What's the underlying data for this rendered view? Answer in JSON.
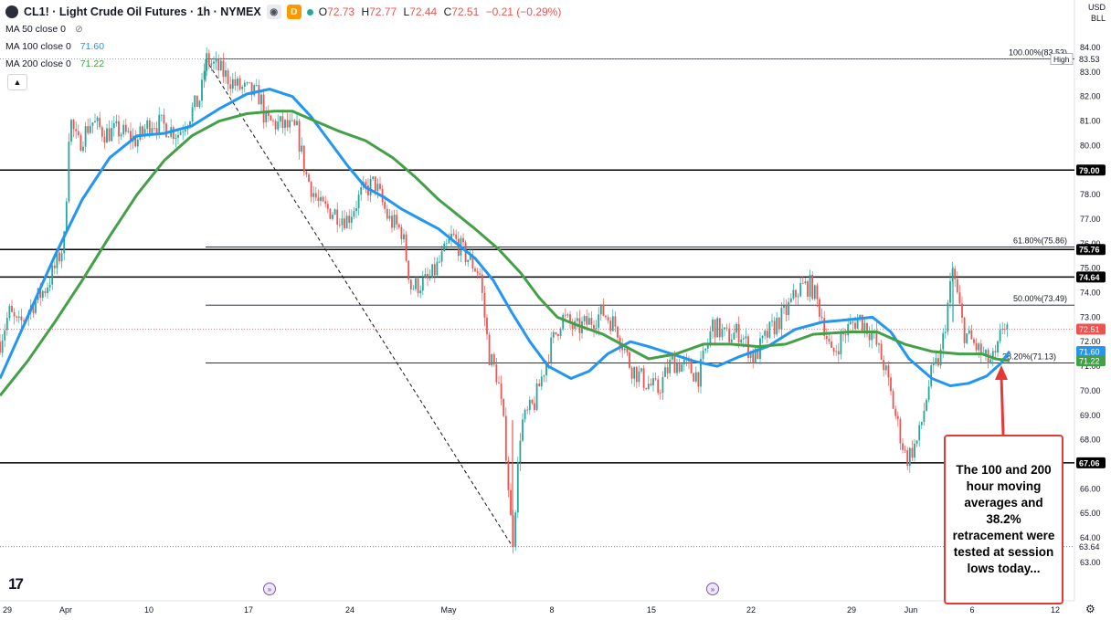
{
  "header": {
    "title": "CL1! · Light Crude Oil Futures · 1h · NYMEX",
    "badge_d": "D",
    "ohlc": [
      {
        "k": "O",
        "v": "72.73"
      },
      {
        "k": "H",
        "v": "72.77"
      },
      {
        "k": "L",
        "v": "72.44"
      },
      {
        "k": "C",
        "v": "72.51"
      }
    ],
    "change": "−0.21 (−0.29%)"
  },
  "indicators": [
    {
      "label": "MA 50 close 0",
      "value": ""
    },
    {
      "label": "MA 100 close 0",
      "value": "71.60"
    },
    {
      "label": "MA 200 close 0",
      "value": "71.22"
    }
  ],
  "currency": {
    "line1": "USD",
    "line2": "BLL"
  },
  "annotation": "The 100 and 200 hour moving averages and 38.2% retracement were tested at session lows today...",
  "colors": {
    "up": "#26a69a",
    "down": "#ef5350",
    "ma100": "#2196f3",
    "ma200": "#43a047",
    "annotation": "#e53935",
    "hline": "#000000",
    "fib": "#131722"
  },
  "chart_data": {
    "type": "candlestick",
    "instrument": "CL1!",
    "timeframe": "1h",
    "xlabel": "",
    "ylabel": "",
    "ylim": [
      62,
      84
    ],
    "y_ticks": [
      63,
      64,
      65,
      66,
      67,
      68,
      69,
      70,
      71,
      72,
      73,
      74,
      75,
      76,
      77,
      78,
      79,
      80,
      81,
      82,
      83,
      84
    ],
    "x_ticks": [
      "29",
      "Apr",
      "10",
      "17",
      "24",
      "May",
      "8",
      "15",
      "22",
      "29",
      "Jun",
      "6",
      "12"
    ],
    "fib_levels": [
      {
        "label": "100.00%(83.53)",
        "value": 83.53
      },
      {
        "label": "61.80%(75.86)",
        "value": 75.86
      },
      {
        "label": "50.00%(73.49)",
        "value": 73.49
      },
      {
        "label": "38.20%(71.13)",
        "value": 71.13
      }
    ],
    "horizontal_lines": [
      79.0,
      75.76,
      74.64,
      67.06
    ],
    "price_badges": [
      {
        "label": "79.00",
        "value": 79.0,
        "kind": "line"
      },
      {
        "label": "75.76",
        "value": 75.76,
        "kind": "line"
      },
      {
        "label": "74.64",
        "value": 74.64,
        "kind": "line"
      },
      {
        "label": "72.51",
        "value": 72.51,
        "kind": "last"
      },
      {
        "label": "71.60",
        "value": 71.6,
        "kind": "ma100"
      },
      {
        "label": "71.22",
        "value": 71.22,
        "kind": "ma200"
      },
      {
        "label": "67.06",
        "value": 67.06,
        "kind": "line"
      },
      {
        "label": "83.53",
        "value": 83.53,
        "kind": "high",
        "tag": "High"
      },
      {
        "label": "63.64",
        "value": 63.64,
        "kind": "low"
      }
    ],
    "last_price": 72.51,
    "price_path": [
      [
        0,
        72.0
      ],
      [
        10,
        73.2
      ],
      [
        20,
        72.6
      ],
      [
        35,
        73.5
      ],
      [
        50,
        74.2
      ],
      [
        60,
        75.0
      ],
      [
        70,
        76.0
      ],
      [
        74,
        79.0
      ],
      [
        76,
        81.2
      ],
      [
        85,
        80.0
      ],
      [
        100,
        81.0
      ],
      [
        115,
        80.5
      ],
      [
        130,
        80.6
      ],
      [
        150,
        80.2
      ],
      [
        165,
        81.0
      ],
      [
        180,
        80.8
      ],
      [
        195,
        80.5
      ],
      [
        210,
        81.4
      ],
      [
        220,
        82.0
      ],
      [
        225,
        83.53
      ],
      [
        240,
        83.1
      ],
      [
        260,
        82.4
      ],
      [
        285,
        82.0
      ],
      [
        290,
        81.0
      ],
      [
        310,
        80.8
      ],
      [
        325,
        80.6
      ],
      [
        335,
        78.8
      ],
      [
        350,
        77.5
      ],
      [
        365,
        77.3
      ],
      [
        380,
        77.0
      ],
      [
        395,
        78.0
      ],
      [
        410,
        78.5
      ],
      [
        425,
        77.0
      ],
      [
        440,
        76.5
      ],
      [
        450,
        74.2
      ],
      [
        470,
        74.5
      ],
      [
        485,
        75.5
      ],
      [
        495,
        76.3
      ],
      [
        510,
        75.5
      ],
      [
        525,
        74.8
      ],
      [
        535,
        71.5
      ],
      [
        545,
        70.5
      ],
      [
        553,
        68.0
      ],
      [
        561,
        63.64
      ],
      [
        570,
        68.6
      ],
      [
        585,
        69.5
      ],
      [
        600,
        71.5
      ],
      [
        615,
        73.0
      ],
      [
        630,
        72.5
      ],
      [
        645,
        72.8
      ],
      [
        660,
        73.2
      ],
      [
        675,
        72.6
      ],
      [
        690,
        71.0
      ],
      [
        705,
        70.4
      ],
      [
        720,
        70.0
      ],
      [
        735,
        71.2
      ],
      [
        750,
        71.0
      ],
      [
        765,
        70.6
      ],
      [
        780,
        72.7
      ],
      [
        795,
        72.2
      ],
      [
        810,
        72.4
      ],
      [
        825,
        71.3
      ],
      [
        840,
        72.3
      ],
      [
        860,
        73.2
      ],
      [
        875,
        74.2
      ],
      [
        888,
        74.3
      ],
      [
        900,
        73.0
      ],
      [
        910,
        71.4
      ],
      [
        925,
        72.4
      ],
      [
        940,
        73.0
      ],
      [
        955,
        72.3
      ],
      [
        968,
        71.0
      ],
      [
        980,
        69.0
      ],
      [
        992,
        67.2
      ],
      [
        1005,
        68.0
      ],
      [
        1018,
        70.5
      ],
      [
        1030,
        71.5
      ],
      [
        1043,
        75.0
      ],
      [
        1048,
        73.8
      ],
      [
        1055,
        72.4
      ],
      [
        1068,
        71.8
      ],
      [
        1080,
        71.2
      ],
      [
        1090,
        71.3
      ],
      [
        1098,
        72.8
      ],
      [
        1105,
        72.51
      ]
    ],
    "series": [
      {
        "name": "MA 100 close 0",
        "values": [
          [
            0,
            70.5
          ],
          [
            30,
            73.0
          ],
          [
            60,
            75.5
          ],
          [
            90,
            77.8
          ],
          [
            120,
            79.5
          ],
          [
            150,
            80.4
          ],
          [
            180,
            80.5
          ],
          [
            210,
            80.8
          ],
          [
            240,
            81.5
          ],
          [
            270,
            82.1
          ],
          [
            295,
            82.3
          ],
          [
            320,
            82.0
          ],
          [
            340,
            81.2
          ],
          [
            360,
            80.2
          ],
          [
            380,
            79.2
          ],
          [
            400,
            78.3
          ],
          [
            420,
            77.9
          ],
          [
            440,
            77.4
          ],
          [
            460,
            77.0
          ],
          [
            480,
            76.6
          ],
          [
            500,
            76.0
          ],
          [
            520,
            75.4
          ],
          [
            540,
            74.5
          ],
          [
            560,
            73.2
          ],
          [
            580,
            72.0
          ],
          [
            600,
            71.0
          ],
          [
            625,
            70.5
          ],
          [
            645,
            70.8
          ],
          [
            665,
            71.5
          ],
          [
            690,
            72.0
          ],
          [
            710,
            71.8
          ],
          [
            735,
            71.5
          ],
          [
            760,
            71.2
          ],
          [
            785,
            71.0
          ],
          [
            810,
            71.4
          ],
          [
            840,
            71.8
          ],
          [
            870,
            72.5
          ],
          [
            900,
            72.8
          ],
          [
            930,
            72.9
          ],
          [
            955,
            73.0
          ],
          [
            975,
            72.4
          ],
          [
            995,
            71.3
          ],
          [
            1020,
            70.5
          ],
          [
            1040,
            70.2
          ],
          [
            1060,
            70.3
          ],
          [
            1080,
            70.6
          ],
          [
            1095,
            71.1
          ],
          [
            1105,
            71.6
          ]
        ]
      },
      {
        "name": "MA 200 close 0",
        "values": [
          [
            0,
            69.8
          ],
          [
            30,
            71.2
          ],
          [
            60,
            72.8
          ],
          [
            90,
            74.5
          ],
          [
            120,
            76.3
          ],
          [
            150,
            78.0
          ],
          [
            180,
            79.4
          ],
          [
            210,
            80.4
          ],
          [
            240,
            81.0
          ],
          [
            270,
            81.3
          ],
          [
            300,
            81.4
          ],
          [
            320,
            81.4
          ],
          [
            345,
            81.0
          ],
          [
            370,
            80.6
          ],
          [
            400,
            80.2
          ],
          [
            430,
            79.5
          ],
          [
            455,
            78.7
          ],
          [
            480,
            77.8
          ],
          [
            500,
            77.2
          ],
          [
            520,
            76.6
          ],
          [
            545,
            75.8
          ],
          [
            570,
            74.8
          ],
          [
            590,
            73.8
          ],
          [
            610,
            73.0
          ],
          [
            630,
            72.7
          ],
          [
            660,
            72.3
          ],
          [
            690,
            71.7
          ],
          [
            710,
            71.3
          ],
          [
            740,
            71.5
          ],
          [
            770,
            71.9
          ],
          [
            800,
            71.9
          ],
          [
            830,
            71.8
          ],
          [
            860,
            71.9
          ],
          [
            890,
            72.3
          ],
          [
            930,
            72.4
          ],
          [
            960,
            72.4
          ],
          [
            990,
            71.9
          ],
          [
            1020,
            71.6
          ],
          [
            1050,
            71.5
          ],
          [
            1075,
            71.5
          ],
          [
            1090,
            71.3
          ],
          [
            1105,
            71.22
          ]
        ]
      }
    ],
    "trend_line": {
      "from": [
        225,
        83.53
      ],
      "to": [
        561,
        63.64
      ],
      "style": "dashed"
    }
  }
}
